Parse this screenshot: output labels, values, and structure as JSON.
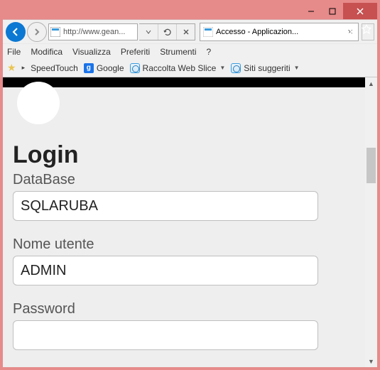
{
  "window": {
    "tab_title": "Accesso - Applicazion...",
    "url": "http://www.gean..."
  },
  "menu": {
    "file": "File",
    "modifica": "Modifica",
    "visualizza": "Visualizza",
    "preferiti": "Preferiti",
    "strumenti": "Strumenti",
    "help": "?"
  },
  "bookmarks": {
    "speedtouch": "SpeedTouch",
    "google": "Google",
    "raccolta": "Raccolta Web Slice",
    "siti": "Siti suggeriti"
  },
  "login": {
    "heading": "Login",
    "database_label": "DataBase",
    "database_value": "SQLARUBA",
    "username_label": "Nome utente",
    "username_value": "ADMIN",
    "password_label": "Password",
    "password_value": ""
  }
}
